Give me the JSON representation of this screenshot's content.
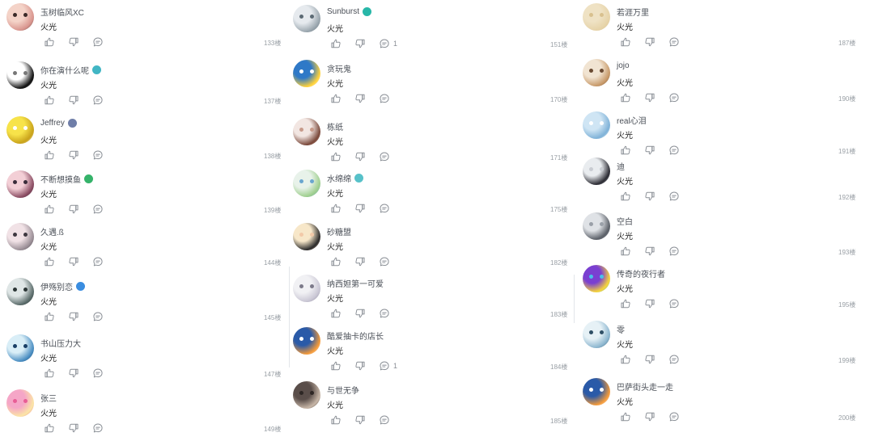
{
  "columns": [
    {
      "comments": [
        {
          "user": "玉树临风XC",
          "text": "火光",
          "floor": "133楼",
          "reply_count": "",
          "badge_color": "",
          "avatar_colors": [
            "#f4d3c8",
            "#d9958e",
            "#3a2a28"
          ]
        },
        {
          "user": "你在演什么呢",
          "text": "火光",
          "floor": "137楼",
          "reply_count": "",
          "badge_color": "#41b6c4",
          "avatar_colors": [
            "#ffffff",
            "#111111",
            "#777777"
          ]
        },
        {
          "user": "Jeffrey",
          "text": "火光",
          "floor": "138楼",
          "reply_count": "",
          "badge_color": "#6f7ea8",
          "avatar_colors": [
            "#f7e34a",
            "#c9a21a",
            "#ffffff"
          ]
        },
        {
          "user": "不断想摸鱼",
          "text": "火光",
          "floor": "139楼",
          "reply_count": "",
          "badge_color": "#35b36a",
          "avatar_colors": [
            "#f3cfd6",
            "#8a4c62",
            "#3a2c3a"
          ]
        },
        {
          "user": "久遇.ß",
          "text": "火光",
          "floor": "144楼",
          "reply_count": "",
          "badge_color": "",
          "avatar_colors": [
            "#f1e2e6",
            "#9a8e96",
            "#3d3840"
          ]
        },
        {
          "user": "伊殇别恋",
          "text": "火光",
          "floor": "145楼",
          "reply_count": "",
          "badge_color": "#3a8de0",
          "avatar_colors": [
            "#dfe6e6",
            "#5a6b6a",
            "#2b3535"
          ]
        },
        {
          "user": "书山压力大",
          "text": "火光",
          "floor": "147楼",
          "reply_count": "",
          "badge_color": "",
          "avatar_colors": [
            "#d9eef7",
            "#4a8ec2",
            "#1a3f66"
          ]
        },
        {
          "user": "张三",
          "text": "火光",
          "floor": "149楼",
          "reply_count": "",
          "badge_color": "",
          "avatar_colors": [
            "#f5a6c7",
            "#fbe6a6",
            "#e85d96"
          ]
        }
      ]
    },
    {
      "comments": [
        {
          "user": "Sunburst",
          "text": "火光",
          "floor": "151楼",
          "reply_count": "1",
          "badge_color": "#28b7a8",
          "avatar_colors": [
            "#e6eaee",
            "#9aa6ae",
            "#5c6a74"
          ]
        },
        {
          "user": "贪玩鬼",
          "text": "火光",
          "floor": "170楼",
          "reply_count": "",
          "badge_color": "",
          "avatar_colors": [
            "#2f79c7",
            "#ffd23a",
            "#ffffff"
          ]
        },
        {
          "user": "栋纸",
          "text": "火光",
          "floor": "171楼",
          "reply_count": "",
          "badge_color": "",
          "avatar_colors": [
            "#f2e6e2",
            "#7b4a3c",
            "#c79a8a"
          ]
        },
        {
          "user": "水绵绵",
          "text": "火光",
          "floor": "175楼",
          "reply_count": "",
          "badge_color": "#57c1c9",
          "avatar_colors": [
            "#e8f2ea",
            "#9fcf8e",
            "#6aa6cf"
          ]
        },
        {
          "user": "砂糖盟",
          "text": "火光",
          "floor": "182楼",
          "reply_count": "",
          "badge_color": "",
          "avatar_colors": [
            "#f7e7c9",
            "#2b2b2b",
            "#f2c9a8"
          ]
        },
        {
          "user": "纳西妲第一可爱",
          "text": "火光",
          "floor": "183楼",
          "reply_count": "",
          "badge_color": "",
          "avatar_colors": [
            "#f1f1f4",
            "#c9c6d4",
            "#7c7a8a"
          ]
        },
        {
          "user": "酷爱抽卡的店长",
          "text": "火光",
          "floor": "184楼",
          "reply_count": "1",
          "badge_color": "",
          "avatar_colors": [
            "#2a5aa8",
            "#f39a3a",
            "#ffffff"
          ]
        },
        {
          "user": "与世无争",
          "text": "火光",
          "floor": "185楼",
          "reply_count": "",
          "badge_color": "",
          "avatar_colors": [
            "#5a4e4a",
            "#c8b7a8",
            "#2d2624"
          ]
        }
      ]
    },
    {
      "comments": [
        {
          "user": "若涯万里",
          "text": "火光",
          "floor": "187楼",
          "reply_count": "",
          "badge_color": "",
          "avatar_colors": [
            "#efe2c4",
            "#e6d3a8",
            "#d8c08e"
          ]
        },
        {
          "user": "jojo",
          "text": "火光",
          "floor": "190楼",
          "reply_count": "",
          "badge_color": "",
          "avatar_colors": [
            "#f1e4d2",
            "#c89a6a",
            "#6a4a32"
          ]
        },
        {
          "user": "real心泪",
          "text": "火光",
          "floor": "191楼",
          "reply_count": "",
          "badge_color": "",
          "avatar_colors": [
            "#cfe5f4",
            "#7fb2d8",
            "#ffffff"
          ]
        },
        {
          "user": "迪",
          "text": "火光",
          "floor": "192楼",
          "reply_count": "",
          "badge_color": "",
          "avatar_colors": [
            "#e9ecef",
            "#2b2b33",
            "#c9ccd2"
          ]
        },
        {
          "user": "空白",
          "text": "火光",
          "floor": "193楼",
          "reply_count": "",
          "badge_color": "",
          "avatar_colors": [
            "#dfe2e6",
            "#5b6068",
            "#9aa0a8"
          ]
        },
        {
          "user": "传奇的夜行者",
          "text": "火光",
          "floor": "195楼",
          "reply_count": "",
          "badge_color": "",
          "avatar_colors": [
            "#7a3fd1",
            "#f7d43a",
            "#49c1e8"
          ]
        },
        {
          "user": "零",
          "text": "火光",
          "floor": "199楼",
          "reply_count": "",
          "badge_color": "",
          "avatar_colors": [
            "#e6f1f6",
            "#8cb6cf",
            "#2f4f66"
          ]
        },
        {
          "user": "巴萨街头走一走",
          "text": "火光",
          "floor": "200楼",
          "reply_count": "",
          "badge_color": "",
          "avatar_colors": [
            "#2a5aa8",
            "#f39a3a",
            "#ffffff"
          ]
        }
      ]
    }
  ]
}
